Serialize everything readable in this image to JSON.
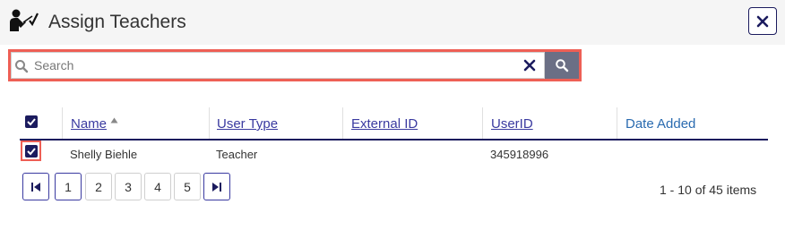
{
  "dialog": {
    "title": "Assign Teachers",
    "icon": "teacher-pointer-icon",
    "close_icon": "close-icon"
  },
  "search": {
    "placeholder": "Search",
    "value": "",
    "clear_icon": "close-icon",
    "button_icon": "search-icon"
  },
  "table": {
    "columns": [
      "Name",
      "User Type",
      "External ID",
      "UserID",
      "Date Added"
    ],
    "sort_column": "Name",
    "sort_direction": "ascending",
    "select_all_checked": true,
    "rows": [
      {
        "selected": true,
        "name": "Shelly Biehle",
        "user_type": "Teacher",
        "external_id": "",
        "user_id": "345918996",
        "date_added": ""
      }
    ]
  },
  "pagination": {
    "pages": [
      "1",
      "2",
      "3",
      "4",
      "5"
    ],
    "current_page": "1",
    "info": "1 - 10 of 45 items"
  },
  "colors": {
    "accent": "#1b1b5e",
    "highlight": "#ee5f55",
    "link": "#3a3aa0",
    "search_button": "#6b6f85"
  }
}
